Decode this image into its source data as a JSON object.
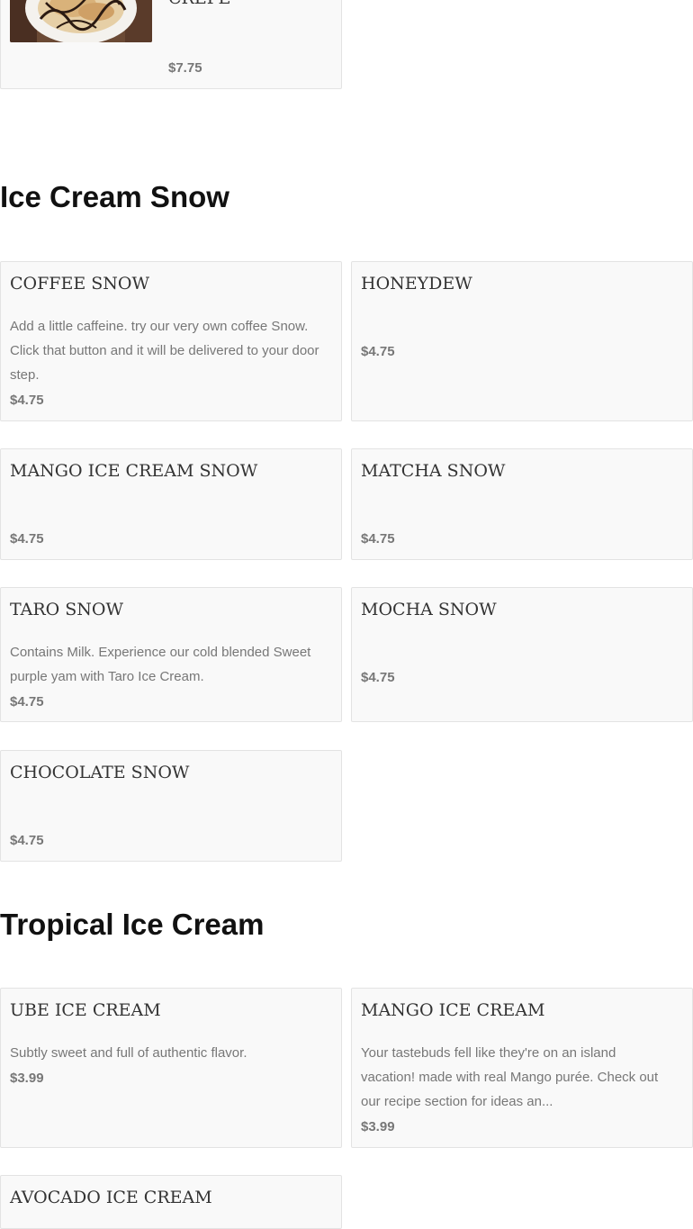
{
  "top_item": {
    "name": "CREPE",
    "price": "$7.75"
  },
  "sections": {
    "ice_cream_snow": {
      "heading": "Ice Cream Snow",
      "items": [
        {
          "name": "COFFEE SNOW",
          "desc": "Add a little caffeine. try our very own coffee Snow. Click that button and it will be delivered to your door step.",
          "price": "$4.75"
        },
        {
          "name": "HONEYDEW",
          "desc": "",
          "price": "$4.75"
        },
        {
          "name": "MANGO ICE CREAM SNOW",
          "desc": "",
          "price": "$4.75"
        },
        {
          "name": "MATCHA SNOW",
          "desc": "",
          "price": "$4.75"
        },
        {
          "name": "TARO SNOW",
          "desc": "Contains Milk. Experience our cold blended Sweet purple yam with Taro Ice Cream.",
          "price": "$4.75"
        },
        {
          "name": "MOCHA SNOW",
          "desc": "",
          "price": "$4.75"
        },
        {
          "name": "CHOCOLATE SNOW",
          "desc": "",
          "price": "$4.75"
        }
      ]
    },
    "tropical_ice_cream": {
      "heading": "Tropical Ice Cream",
      "items": [
        {
          "name": "UBE ICE CREAM",
          "desc": "Subtly sweet and full of authentic flavor.",
          "price": "$3.99"
        },
        {
          "name": "MANGO ICE CREAM",
          "desc": "Your tastebuds fell like they're on an island vacation! made with real Mango purée. Check out our recipe section for ideas an...",
          "price": "$3.99"
        },
        {
          "name": "AVOCADO ICE CREAM",
          "desc": "",
          "price": ""
        }
      ]
    }
  },
  "colors": {
    "card_bg": "#f9f9f9",
    "card_border": "#e3e3e3",
    "title": "#333333",
    "body_text": "#777777",
    "heading": "#111111"
  },
  "icons": {
    "crepe_thumbnail": "crepe-photo"
  }
}
